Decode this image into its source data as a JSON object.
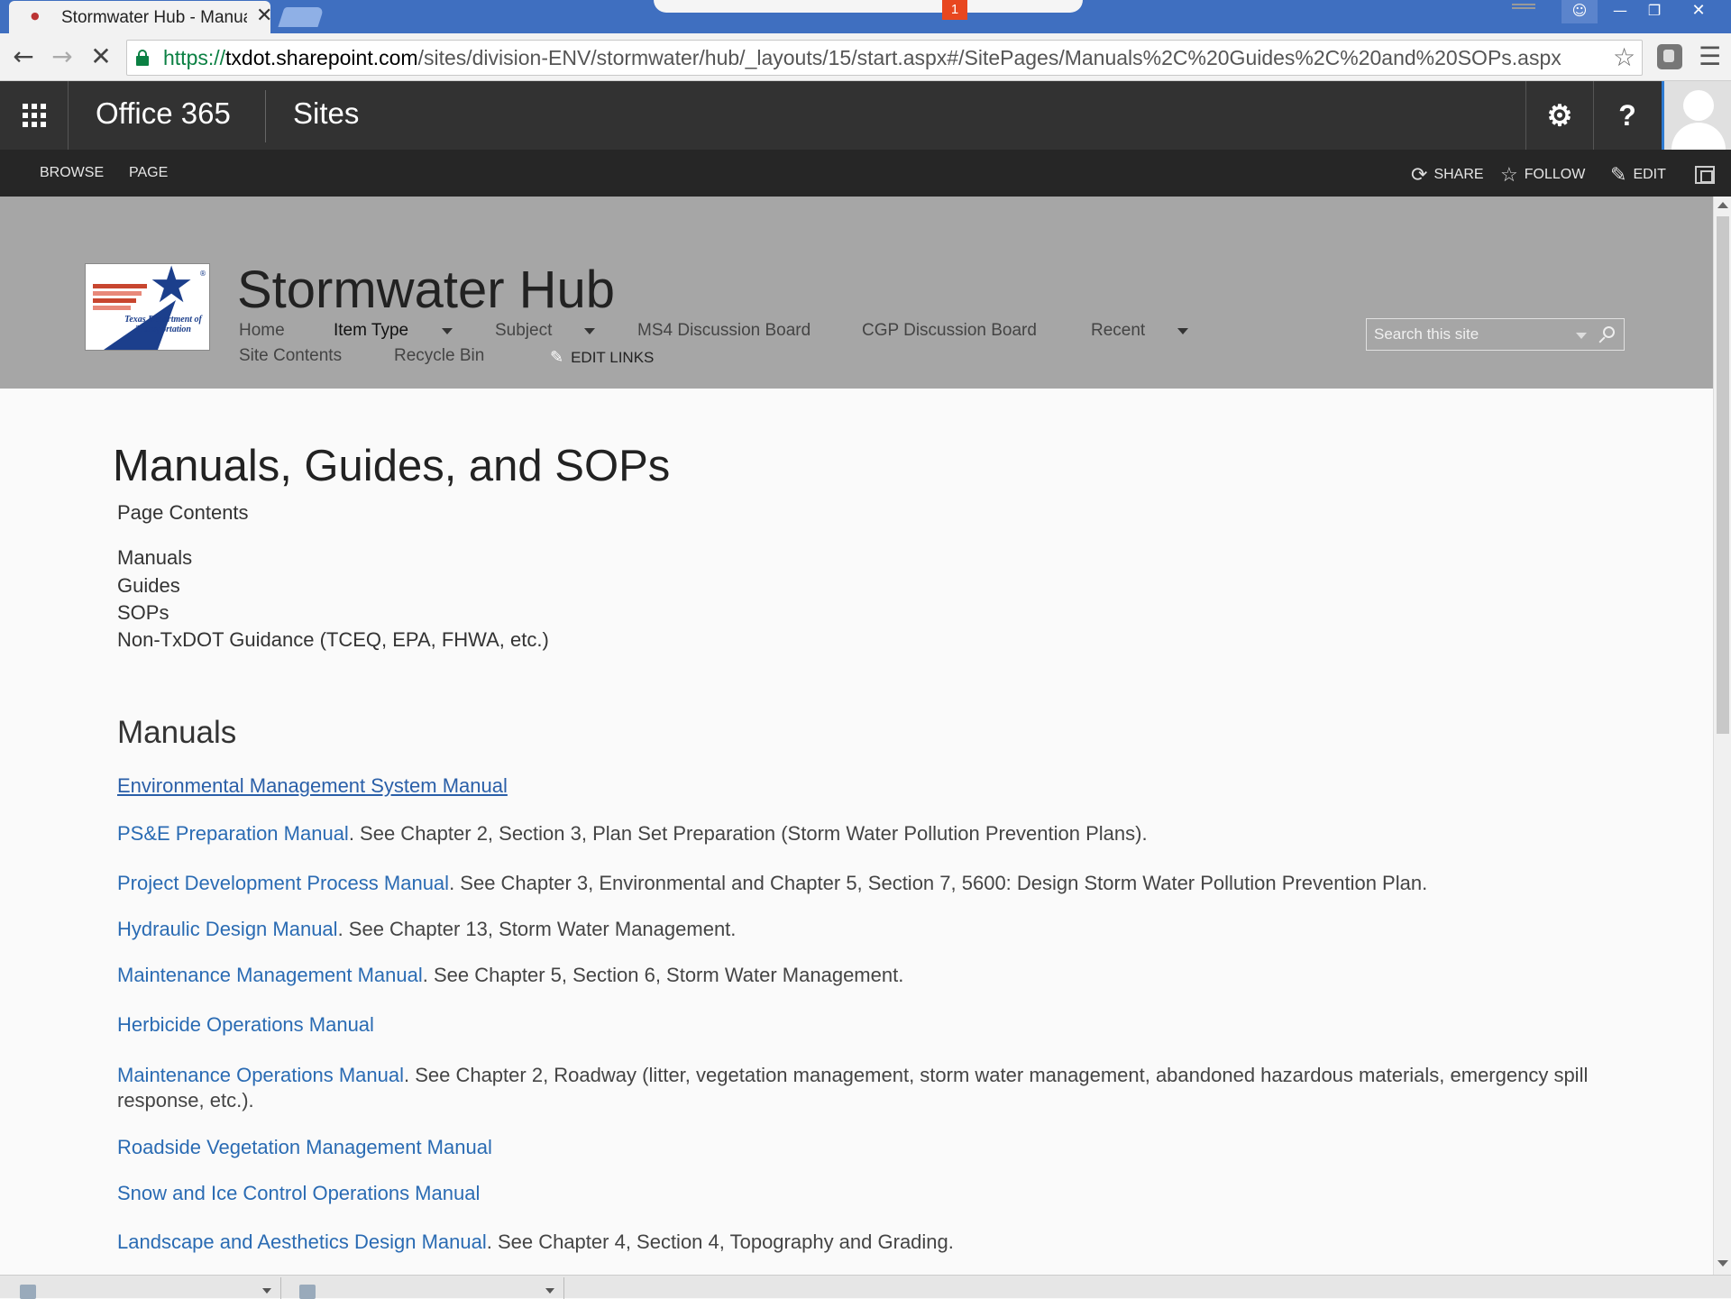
{
  "browser": {
    "tab_title": "Stormwater Hub - Manuals, Guides, and SOPs",
    "notification_count": "1",
    "url_scheme": "https://",
    "url_host": "txdot.sharepoint.com",
    "url_path": "/sites/division-ENV/stormwater/hub/_layouts/15/start.aspx#/SitePages/Manuals%2C%20Guides%2C%20and%20SOPs.aspx"
  },
  "suite_bar": {
    "brand": "Office 365",
    "app": "Sites",
    "help_label": "?"
  },
  "ribbon": {
    "tabs": [
      "BROWSE",
      "PAGE"
    ],
    "share": "SHARE",
    "follow": "FOLLOW",
    "edit": "EDIT"
  },
  "site": {
    "logo_text": "Texas Department of Transportation",
    "title": "Stormwater Hub",
    "nav": [
      "Home",
      "Item Type",
      "Subject",
      "MS4 Discussion Board",
      "CGP Discussion Board",
      "Recent",
      "Site Contents",
      "Recycle Bin"
    ],
    "edit_links": "EDIT LINKS",
    "search_placeholder": "Search this site"
  },
  "page": {
    "title": "Manuals, Guides, and SOPs",
    "toc_heading": "Page Contents",
    "toc": [
      "Manuals",
      "Guides",
      "SOPs",
      "Non-TxDOT Guidance (TCEQ, EPA, FHWA, etc.)"
    ],
    "section_heading": "Manuals",
    "entries": [
      {
        "link": "Environmental Management System Manual",
        "text": ""
      },
      {
        "link": "PS&E Preparation Manual",
        "text": ". See Chapter 2, Section 3, Plan Set Preparation (Storm Water Pollution Prevention Plans)."
      },
      {
        "link": "Project Development Process Manual",
        "text": ".  See Chapter 3, Environmental and Chapter 5, Section 7, 5600:  Design Storm Water Pollution Prevention Plan."
      },
      {
        "link": "Hydraulic Design Manual",
        "text": ".  See Chapter 13, Storm Water Management."
      },
      {
        "link": "Maintenance Management Manual",
        "text": ".  See Chapter 5, Section 6, Storm Water Management."
      },
      {
        "link": "Herbicide Operations Manual",
        "text": ""
      },
      {
        "link": "Maintenance Operations Manual",
        "text": ".  See Chapter 2, Roadway (litter, vegetation management, storm water management, abandoned hazardous materials, emergency spill response, etc.)."
      },
      {
        "link": "Roadside Vegetation Management Manual",
        "text": ""
      },
      {
        "link": "Snow and Ice Control Operations Manual",
        "text": ""
      },
      {
        "link": "Landscape and Aesthetics Design Manual",
        "text": ".  See Chapter 4, Section 4, Topography and Grading."
      }
    ]
  },
  "colors": {
    "link": "#2a6bb3",
    "suite_bar": "#323232",
    "ribbon": "#262626",
    "site_header": "#a6a6a6",
    "titlebar": "#3f6fc0"
  }
}
